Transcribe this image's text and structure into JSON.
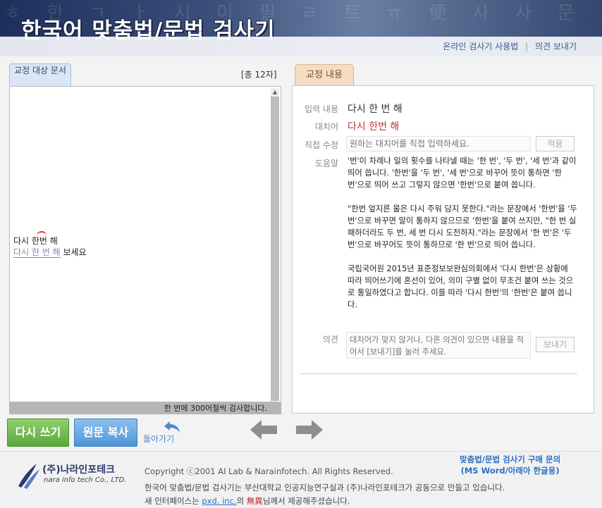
{
  "header": {
    "title": "한국어 맞춤법/문법 검사기",
    "bg_text": "ㅎ 한 ㄱ ㅏ 시 이 필 ㄹ 트 ㅠ 便 사 사 문 로 ㄴ 이 文 ㄴ 어 ㅓ 문 ㅎ 기 ㄷ 법 ㄹ 이",
    "links": [
      "온라인 검사기 사용법",
      "의견 보내기"
    ],
    "separator": "|"
  },
  "left": {
    "tab_label": "교정 대상 문서",
    "char_count": "[총 12자]",
    "doc_line1": "다시 한번 해",
    "doc_line2_marked": "다시 한 번 해",
    "doc_line2_rest": " 보세요",
    "footer_note": "한 번에 300어절씩 검사합니다."
  },
  "right": {
    "tab_label": "교정 내용",
    "input_label": "입력 내용",
    "input_value": "다시 한 번 해",
    "alt_label": "대치어",
    "alt_value": "다시 한번 해",
    "direct_label": "직접 수정",
    "direct_placeholder": "원하는 대치어를 직접 입력하세요.",
    "apply_button": "적용",
    "help_label": "도움말",
    "help_paragraphs": [
      "'번'이 차례나 일의 횟수를 나타낼 때는 '한 번', '두 번', '세 번'과 같이 띄어 씁니다. '한번'을 '두 번', '세 번'으로 바꾸어 뜻이 통하면 '한 번'으로 띄어 쓰고 그렇지 않으면 '한번'으로 붙여 씁니다.",
      "\"한번 엎지른 물은 다시 주워 담지 못한다.\"라는 문장에서 '한번'을 '두 번'으로 바꾸면 말이 통하지 않으므로 '한번'을 붙여 쓰지만, \"한 번 실패하더라도 두 번, 세 번 다시 도전하자.\"라는 문장에서 '한 번'은 '두 번'으로 바꾸어도 뜻이 통하므로 '한 번'으로 띄어 씁니다.",
      "국립국어원 2015년 표준정보보완심의회에서 '다시 한번'은 상황에 따라 띄어쓰기에 혼선이 있어, 의미 구별 없이 무조건 붙여 쓰는 것으로 통일하였다고 합니다. 이를 따라 '다시 한번'의 '한번'은 붙여 씁니다."
    ],
    "opinion_label": "의견",
    "opinion_placeholder": "대치어가 맞지 않거나, 다른 의견이 있으면 내용을 적어서 [보내기]를 눌러 주세요.",
    "send_button": "보내기"
  },
  "bottom": {
    "retry_button": "다시 쓰기",
    "copy_button": "원문 복사",
    "back_label": "돌아가기"
  },
  "footer": {
    "logo_kor": "(주)나라인포테크",
    "logo_eng": "nara info tech Co., LTD.",
    "copyright": "Copyright ⓒ2001 AI Lab & Narainfotech. All Rights Reserved.",
    "line2": "한국어 맞춤법/문법 검사기는 부산대학교 인공지능연구실과 (주)나라인포테크가 공동으로 만들고 있습니다.",
    "line3_prefix": "새 인터페이스는 ",
    "line3_link": "pxd. inc.",
    "line3_mid": "의 ",
    "line3_red": "無異",
    "line3_suffix": "님께서 제공해주셨습니다.",
    "purchase_line1": "맞춤법/문법 검사기 구매 문의",
    "purchase_line2": "(MS Word/아래아 한글용)"
  },
  "colors": {
    "alt_text": "#c3382f",
    "retry_button": "#6ab84a",
    "copy_button": "#5ea3e0",
    "link": "#2d6fc4"
  }
}
